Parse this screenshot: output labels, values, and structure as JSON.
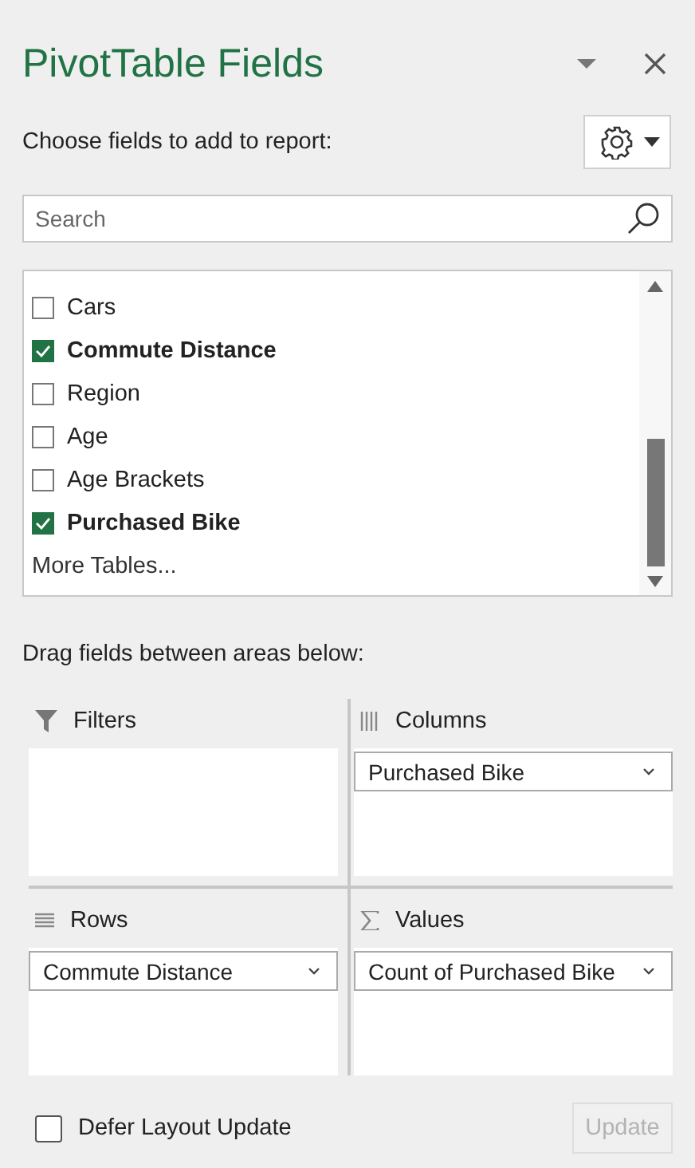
{
  "pane": {
    "title": "PivotTable Fields",
    "prompt": "Choose fields to add to report:"
  },
  "search": {
    "placeholder": "Search"
  },
  "fields": [
    {
      "label": "Cars",
      "checked": false
    },
    {
      "label": "Commute Distance",
      "checked": true
    },
    {
      "label": "Region",
      "checked": false
    },
    {
      "label": "Age",
      "checked": false
    },
    {
      "label": "Age Brackets",
      "checked": false
    },
    {
      "label": "Purchased Bike",
      "checked": true
    }
  ],
  "more_tables": "More Tables...",
  "areas_prompt": "Drag fields between areas below:",
  "areas": [
    {
      "kind": "filters",
      "label": "Filters"
    },
    {
      "kind": "columns",
      "label": "Columns",
      "items": [
        "Purchased Bike"
      ]
    },
    {
      "kind": "rows",
      "label": "Rows",
      "items": [
        "Commute Distance"
      ]
    },
    {
      "kind": "values",
      "label": "Values",
      "items": [
        "Count of Purchased Bike"
      ]
    }
  ],
  "defer": {
    "label": "Defer Layout Update",
    "checked": false
  },
  "update_button": {
    "label": "Update",
    "disabled": true
  }
}
